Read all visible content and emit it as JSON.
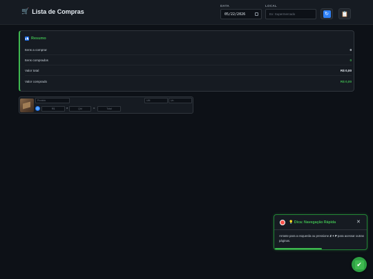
{
  "header": {
    "title": "Lista de Compras",
    "cart_icon": "🛒",
    "date_label": "DATA",
    "date_value": "05/22/2026",
    "local_label": "LOCAL",
    "local_placeholder": "Ex: Supermercado",
    "refresh_icon": "↻",
    "clipboard_icon": "📋"
  },
  "summary": {
    "title": "Resumo",
    "rows": [
      {
        "label": "Itens a comprar",
        "value": "0"
      },
      {
        "label": "Itens comprados",
        "value": "0"
      },
      {
        "label": "Valor total",
        "value": "R$ 0,00"
      },
      {
        "label": "Valor comprado",
        "value": "R$ 0,00"
      }
    ]
  },
  "item": {
    "product_placeholder": "Produto",
    "unit_options": [
      "UM",
      "Un"
    ],
    "price_placeholder": "R$",
    "times": "×",
    "qty_placeholder": "Qtd",
    "equals": "=",
    "total_placeholder": "Total"
  },
  "toast": {
    "title": "💡 Dica: Navegação Rápida",
    "close": "✕",
    "body_pre": "Arraste para a esquerda ou pressione ",
    "keys": "Z + P",
    "body_post": " para acessar outras páginas.",
    "progress": 0.51
  },
  "fab": {
    "icon": "✔"
  },
  "colors": {
    "accent_green": "#3fb950",
    "accent_blue": "#2f81f7",
    "background": "#0d1117"
  }
}
